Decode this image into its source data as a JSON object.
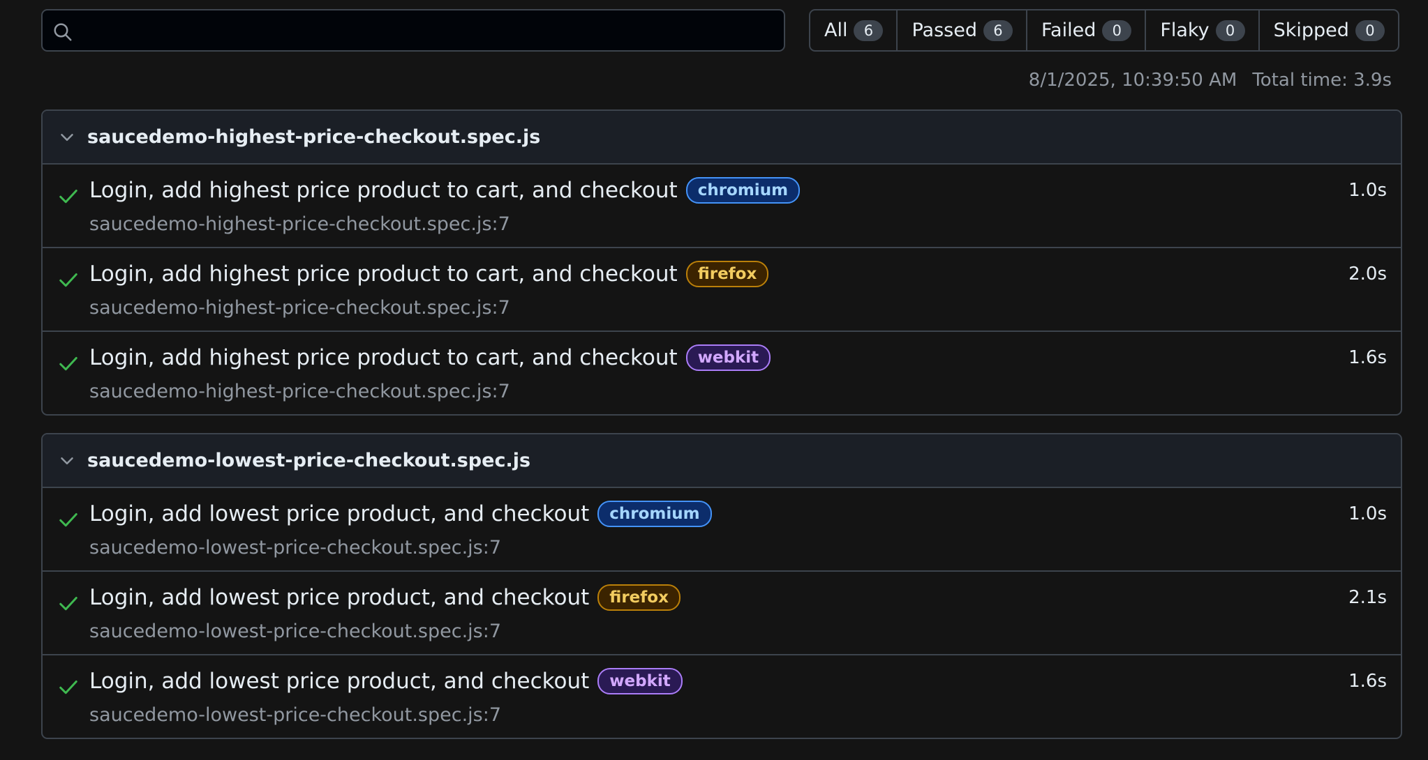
{
  "search": {
    "value": "",
    "placeholder": ""
  },
  "filters": [
    {
      "label": "All",
      "count": "6"
    },
    {
      "label": "Passed",
      "count": "6"
    },
    {
      "label": "Failed",
      "count": "0"
    },
    {
      "label": "Flaky",
      "count": "0"
    },
    {
      "label": "Skipped",
      "count": "0"
    }
  ],
  "meta": {
    "timestamp": "8/1/2025, 10:39:50 AM",
    "total_time": "Total time: 3.9s"
  },
  "colors": {
    "pass": "#3fb950",
    "chromium": "#4493f8",
    "firefox": "#bb8009",
    "webkit": "#ab7df8"
  },
  "specs": [
    {
      "file": "saucedemo-highest-price-checkout.spec.js",
      "tests": [
        {
          "status_icon": "check-icon",
          "title": "Login, add highest price product to cart, and checkout",
          "project": "chromium",
          "location": "saucedemo-highest-price-checkout.spec.js:7",
          "duration": "1.0s"
        },
        {
          "status_icon": "check-icon",
          "title": "Login, add highest price product to cart, and checkout",
          "project": "firefox",
          "location": "saucedemo-highest-price-checkout.spec.js:7",
          "duration": "2.0s"
        },
        {
          "status_icon": "check-icon",
          "title": "Login, add highest price product to cart, and checkout",
          "project": "webkit",
          "location": "saucedemo-highest-price-checkout.spec.js:7",
          "duration": "1.6s"
        }
      ]
    },
    {
      "file": "saucedemo-lowest-price-checkout.spec.js",
      "tests": [
        {
          "status_icon": "check-icon",
          "title": "Login, add lowest price product, and checkout",
          "project": "chromium",
          "location": "saucedemo-lowest-price-checkout.spec.js:7",
          "duration": "1.0s"
        },
        {
          "status_icon": "check-icon",
          "title": "Login, add lowest price product, and checkout",
          "project": "firefox",
          "location": "saucedemo-lowest-price-checkout.spec.js:7",
          "duration": "2.1s"
        },
        {
          "status_icon": "check-icon",
          "title": "Login, add lowest price product, and checkout",
          "project": "webkit",
          "location": "saucedemo-lowest-price-checkout.spec.js:7",
          "duration": "1.6s"
        }
      ]
    }
  ]
}
